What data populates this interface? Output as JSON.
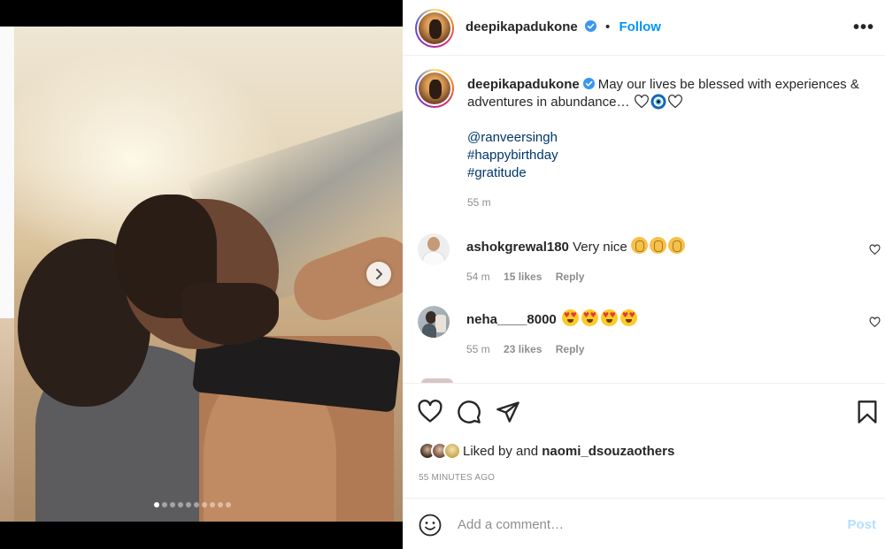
{
  "post": {
    "username": "deepikapadukone",
    "follow_label": "Follow",
    "separator": "•",
    "more_label": "•••",
    "caption": {
      "username": "deepikapadukone",
      "text": "May our lives be blessed with experiences & adventures in abundance…",
      "emojis": [
        "white-heart",
        "nazar-amulet",
        "white-heart"
      ],
      "tags": [
        "@ranveersingh",
        "#happybirthday",
        "#gratitude"
      ],
      "time": "55 m"
    },
    "carousel": {
      "slide_count": 10,
      "active_index": 0
    }
  },
  "comments": [
    {
      "username": "ashokgrewal180",
      "text": "Very nice",
      "emoji": "clapping-hands",
      "emoji_count": 3,
      "time": "54 m",
      "likes": "15 likes",
      "reply": "Reply"
    },
    {
      "username": "neha____8000",
      "text": "",
      "emoji": "heart-eyes",
      "emoji_count": 4,
      "time": "55 m",
      "likes": "23 likes",
      "reply": "Reply"
    }
  ],
  "engagement": {
    "liked_by_prefix": "Liked by",
    "liked_by_and": "and",
    "liked_by_user": "naomi_dsouza",
    "liked_by_suffix": "others",
    "post_time": "55 MINUTES AGO"
  },
  "add_comment": {
    "placeholder": "Add a comment…",
    "post_label": "Post"
  },
  "colors": {
    "link": "#00376b",
    "follow": "#0095f6",
    "muted": "#8e8e8e",
    "post_disabled": "#b2dffc"
  }
}
